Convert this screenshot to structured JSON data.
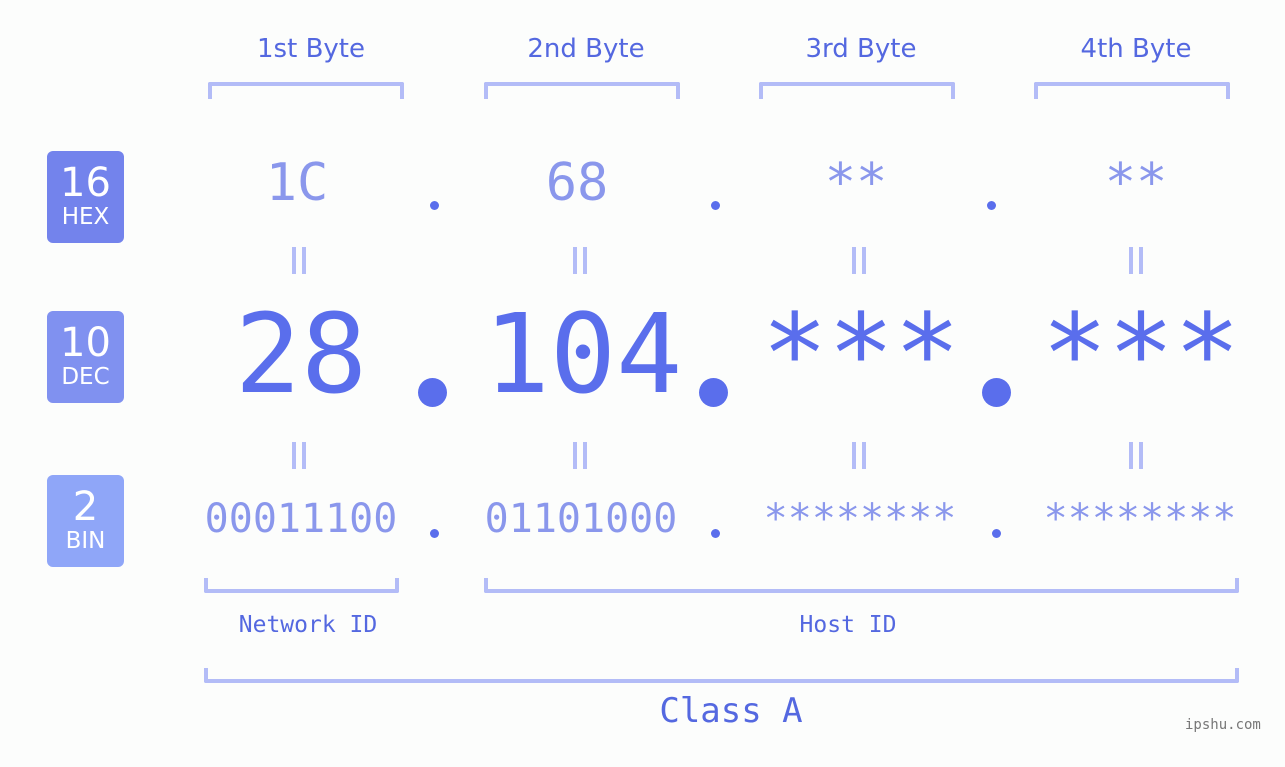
{
  "headers": [
    "1st Byte",
    "2nd Byte",
    "3rd Byte",
    "4th Byte"
  ],
  "badges": {
    "hex": {
      "number": "16",
      "label": "HEX",
      "color": "#7383ec"
    },
    "dec": {
      "number": "10",
      "label": "DEC",
      "color": "#8091f0"
    },
    "bin": {
      "number": "2",
      "label": "BIN",
      "color": "#8fa6f8"
    }
  },
  "hex_values": [
    "1C",
    "68",
    "**",
    "**"
  ],
  "dec_values": [
    "28",
    "104",
    "***",
    "***"
  ],
  "bin_values": [
    "00011100",
    "01101000",
    "********",
    "********"
  ],
  "separator": ".",
  "network_id_label": "Network ID",
  "host_id_label": "Host ID",
  "class_label": "Class A",
  "watermark": "ipshu.com",
  "colors": {
    "accent": "#5a6eec",
    "light_value": "#8a97ec",
    "bracket": "#b3bcf7",
    "background": "#fcfdfc"
  }
}
